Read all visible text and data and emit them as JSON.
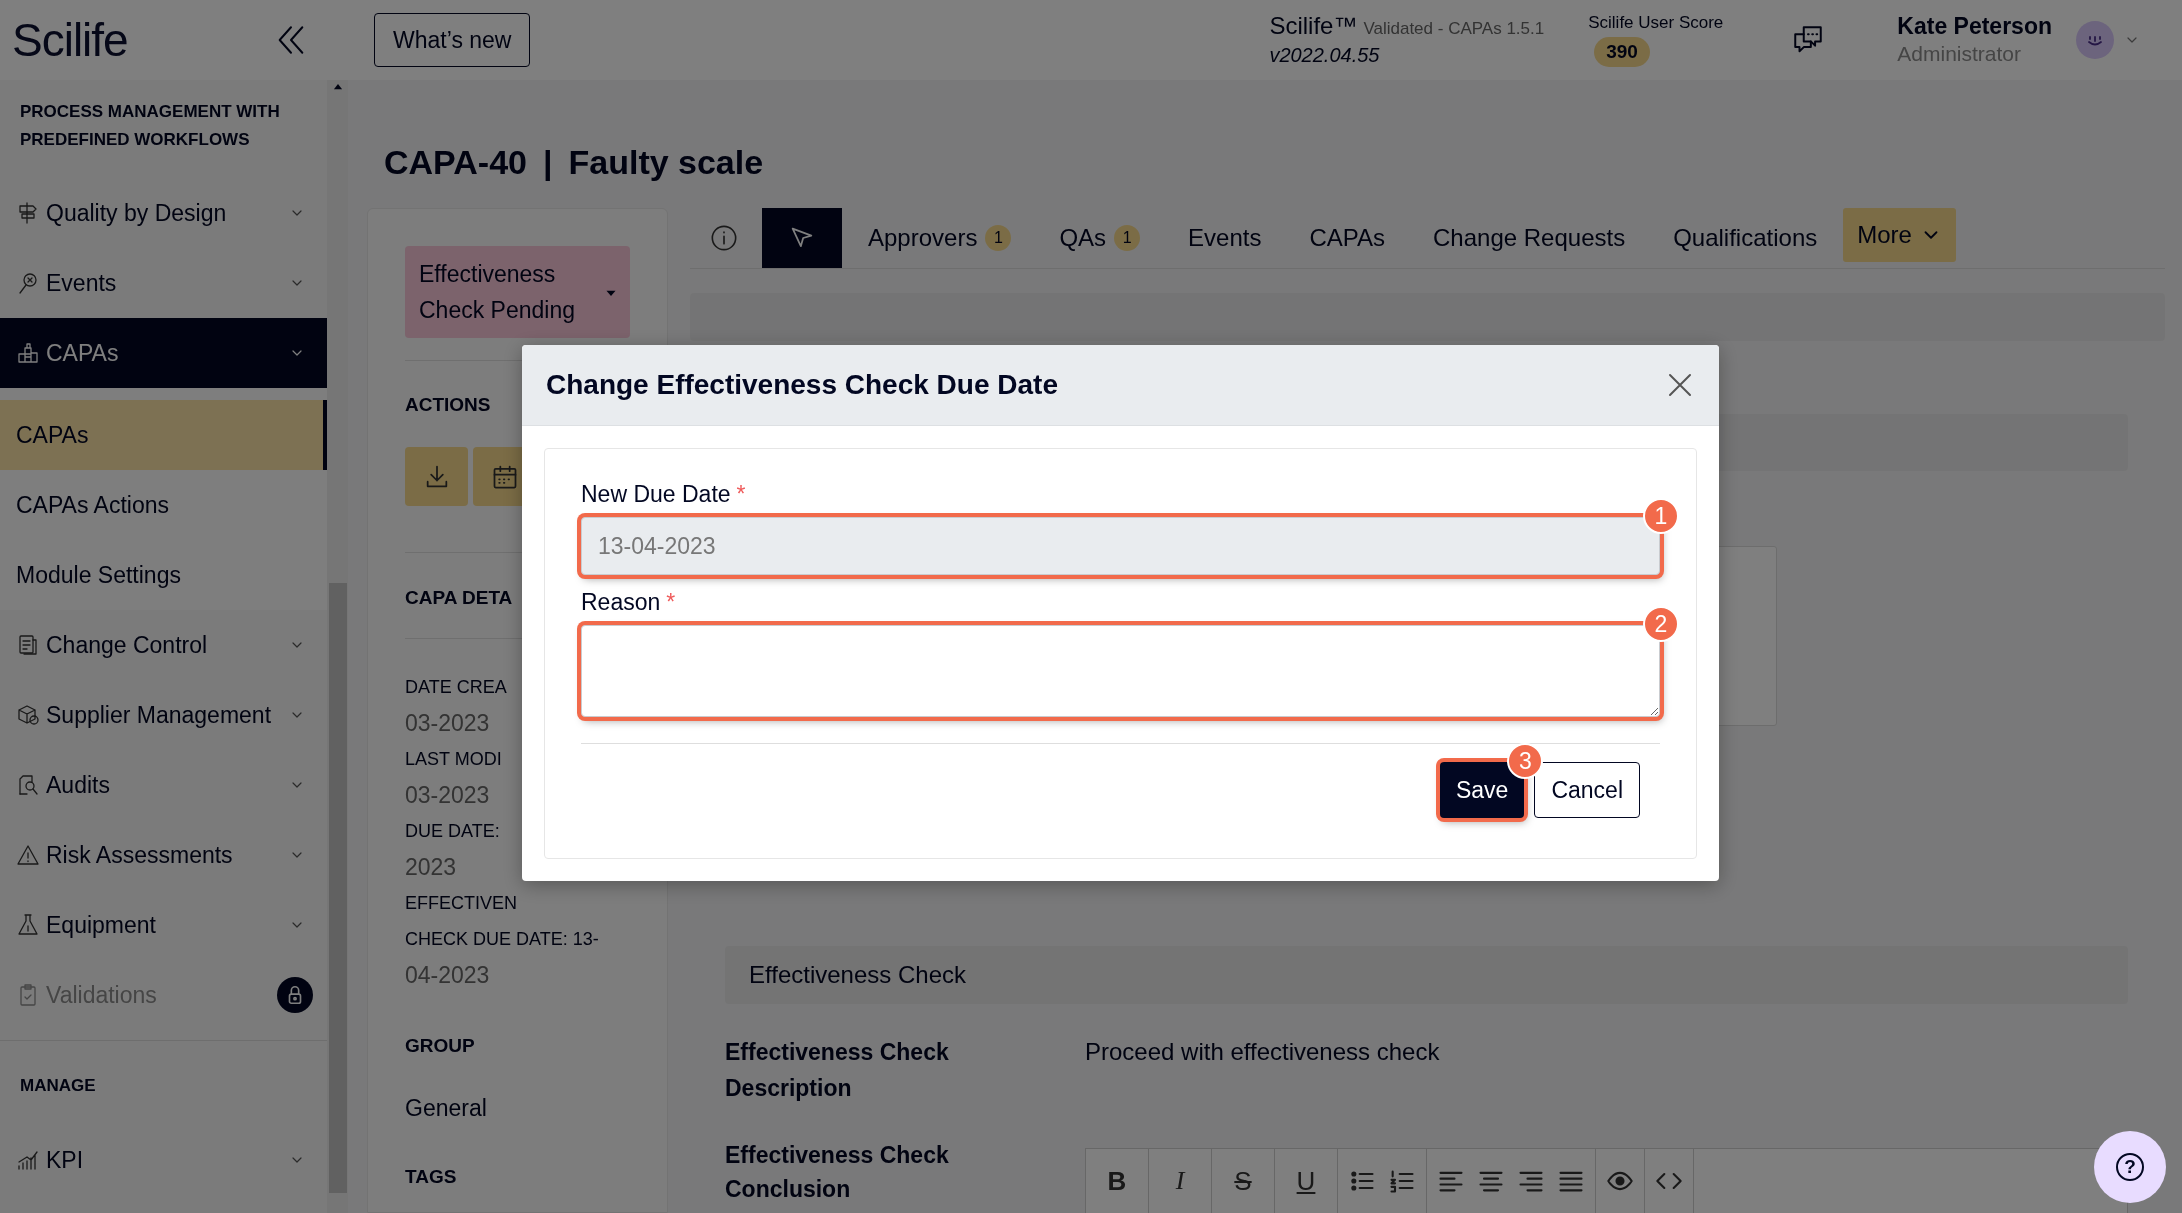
{
  "sidebar": {
    "logo": "Scilife",
    "section": "PROCESS MANAGEMENT WITH PREDEFINED WORKFLOWS",
    "items": [
      {
        "label": "Quality by Design",
        "kind": "signpost",
        "selected": false,
        "locked": false
      },
      {
        "label": "Events",
        "kind": "pin",
        "selected": false,
        "locked": false
      },
      {
        "label": "CAPAs",
        "kind": "puzzle",
        "selected": true,
        "locked": false,
        "children": [
          {
            "label": "CAPAs",
            "selected": true
          },
          {
            "label": "CAPAs Actions",
            "selected": false
          },
          {
            "label": "Module Settings",
            "selected": false
          }
        ]
      },
      {
        "label": "Change Control",
        "kind": "clipboard",
        "selected": false,
        "locked": false
      },
      {
        "label": "Supplier Management",
        "kind": "boxes",
        "selected": false,
        "locked": false
      },
      {
        "label": "Audits",
        "kind": "audit",
        "selected": false,
        "locked": false
      },
      {
        "label": "Risk Assessments",
        "kind": "warning",
        "selected": false,
        "locked": false
      },
      {
        "label": "Equipment",
        "kind": "flask",
        "selected": false,
        "locked": false
      },
      {
        "label": "Validations",
        "kind": "clipboard-check",
        "selected": false,
        "locked": true
      }
    ],
    "manage_section": "MANAGE",
    "manage_items": [
      {
        "label": "KPI",
        "kind": "chart",
        "selected": false,
        "locked": false
      }
    ]
  },
  "topbar": {
    "whats_new": "What’s new",
    "product": "Scilife™",
    "validation": "Validated - CAPAs 1.5.1",
    "version": "v2022.04.55",
    "score_label": "Scilife User Score",
    "score": "390",
    "user_name": "Kate Peterson",
    "user_role": "Administrator"
  },
  "record": {
    "id": "CAPA-40",
    "separator": "|",
    "name": "Faulty scale"
  },
  "summary": {
    "status": "Effectiveness Check Pending",
    "actions_heading": "ACTIONS",
    "actions": [
      {
        "kind": "download"
      },
      {
        "kind": "calendar"
      }
    ],
    "details_heading": "CAPA DETA",
    "details": [
      {
        "kind": "label",
        "text": "DATE CREA"
      },
      {
        "kind": "value",
        "text": "03-2023"
      },
      {
        "kind": "label",
        "text": "LAST MODI"
      },
      {
        "kind": "value",
        "text": "03-2023"
      },
      {
        "kind": "label",
        "text": "DUE DATE:"
      },
      {
        "kind": "value",
        "text": "2023"
      },
      {
        "kind": "label",
        "text": "EFFECTIVEN"
      },
      {
        "kind": "label",
        "text": "CHECK DUE DATE: 13-"
      },
      {
        "kind": "value",
        "text": "04-2023"
      }
    ],
    "group_heading": "GROUP",
    "group": "General",
    "tags_heading": "TAGS"
  },
  "tabs": [
    {
      "kind": "info",
      "selected": false
    },
    {
      "kind": "cursor",
      "selected": true
    },
    {
      "kind": "text",
      "label": "Approvers",
      "count": "1",
      "selected": false
    },
    {
      "kind": "text",
      "label": "QAs",
      "count": "1",
      "selected": false
    },
    {
      "kind": "text",
      "label": "Events",
      "selected": false
    },
    {
      "kind": "text",
      "label": "CAPAs",
      "selected": false
    },
    {
      "kind": "text",
      "label": "Change Requests",
      "selected": false
    },
    {
      "kind": "text",
      "label": "Qualifications",
      "selected": false
    },
    {
      "kind": "menu",
      "label": "More",
      "selected": false
    }
  ],
  "effectiveness": {
    "section": "Effectiveness Check",
    "description": {
      "label": "Effectiveness Check Description",
      "value": "Proceed with effectiveness check"
    },
    "conclusion": {
      "label": "Effectiveness Check Conclusion",
      "toolbar": [
        {
          "buttons": [
            {
              "kind": "bold",
              "label": "B"
            }
          ]
        },
        {
          "buttons": [
            {
              "kind": "italic",
              "label": "I"
            }
          ]
        },
        {
          "buttons": [
            {
              "kind": "strike",
              "label": "S"
            }
          ]
        },
        {
          "buttons": [
            {
              "kind": "underline",
              "label": "U"
            }
          ]
        },
        {
          "buttons": [
            {
              "kind": "bullets"
            },
            {
              "kind": "numbers"
            }
          ]
        },
        {
          "buttons": [
            {
              "kind": "align-left"
            },
            {
              "kind": "align-center"
            },
            {
              "kind": "align-right"
            },
            {
              "kind": "justify"
            }
          ]
        },
        {
          "buttons": [
            {
              "kind": "preview"
            }
          ]
        },
        {
          "buttons": [
            {
              "kind": "code"
            }
          ]
        }
      ]
    }
  },
  "modal": {
    "title": "Change Effectiveness Check Due Date",
    "fields": [
      {
        "kind": "input",
        "label": "New Due Date",
        "required_mark": "*",
        "value": "13-04-2023",
        "disabled": true,
        "marker": "1"
      },
      {
        "kind": "textarea",
        "label": "Reason",
        "required_mark": "*",
        "disabled": false,
        "marker": "2"
      }
    ],
    "save": {
      "label": "Save",
      "marker": "3"
    },
    "cancel": "Cancel"
  },
  "help_button": "?"
}
